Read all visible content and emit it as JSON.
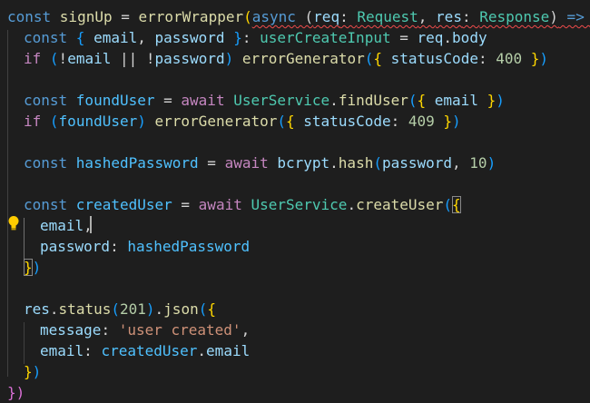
{
  "editor": {
    "lines": [
      [
        [
          "const ",
          "kw"
        ],
        [
          "signUp",
          "fn"
        ],
        [
          " = ",
          "punc"
        ],
        [
          "errorWrapper",
          "fn"
        ],
        [
          "(",
          "brace1"
        ],
        [
          "async",
          "kw sq"
        ],
        [
          " (",
          "punc sq"
        ],
        [
          "req",
          "var sq"
        ],
        [
          ": ",
          "punc sq"
        ],
        [
          "Request",
          "type sq"
        ],
        [
          ", ",
          "punc sq"
        ],
        [
          "res",
          "var sq"
        ],
        [
          ": ",
          "punc sq"
        ],
        [
          "Response",
          "type sq"
        ],
        [
          ")",
          "punc sq"
        ],
        [
          " => ",
          "kw sq"
        ],
        [
          "{",
          "brace2 sq"
        ]
      ],
      [
        [
          "const ",
          "kw"
        ],
        [
          "{ ",
          "brace3"
        ],
        [
          "email",
          "var"
        ],
        [
          ", ",
          "punc"
        ],
        [
          "password",
          "var"
        ],
        [
          " }",
          "brace3"
        ],
        [
          ": ",
          "punc"
        ],
        [
          "userCreateInput",
          "type"
        ],
        [
          " = ",
          "punc"
        ],
        [
          "req",
          "var"
        ],
        [
          ".",
          "punc"
        ],
        [
          "body",
          "var"
        ]
      ],
      [
        [
          "if ",
          "ctrl"
        ],
        [
          "(",
          "brace3"
        ],
        [
          "!",
          "punc"
        ],
        [
          "email",
          "var"
        ],
        [
          " || ",
          "punc"
        ],
        [
          "!",
          "punc"
        ],
        [
          "password",
          "var"
        ],
        [
          ") ",
          "brace3"
        ],
        [
          "errorGenerator",
          "fn"
        ],
        [
          "(",
          "brace3"
        ],
        [
          "{ ",
          "brace1"
        ],
        [
          "statusCode",
          "var"
        ],
        [
          ": ",
          "punc"
        ],
        [
          "400",
          "num"
        ],
        [
          " }",
          "brace1"
        ],
        [
          ")",
          "brace3"
        ]
      ],
      [],
      [
        [
          "const ",
          "kw"
        ],
        [
          "foundUser",
          "const"
        ],
        [
          " = ",
          "punc"
        ],
        [
          "await ",
          "ctrl"
        ],
        [
          "UserService",
          "type"
        ],
        [
          ".",
          "punc"
        ],
        [
          "findUser",
          "fn"
        ],
        [
          "(",
          "brace3"
        ],
        [
          "{ ",
          "brace1"
        ],
        [
          "email",
          "var"
        ],
        [
          " }",
          "brace1"
        ],
        [
          ")",
          "brace3"
        ]
      ],
      [
        [
          "if ",
          "ctrl"
        ],
        [
          "(",
          "brace3"
        ],
        [
          "foundUser",
          "const"
        ],
        [
          ") ",
          "brace3"
        ],
        [
          "errorGenerator",
          "fn"
        ],
        [
          "(",
          "brace3"
        ],
        [
          "{ ",
          "brace1"
        ],
        [
          "statusCode",
          "var"
        ],
        [
          ": ",
          "punc"
        ],
        [
          "409",
          "num"
        ],
        [
          " }",
          "brace1"
        ],
        [
          ")",
          "brace3"
        ]
      ],
      [],
      [
        [
          "const ",
          "kw"
        ],
        [
          "hashedPassword",
          "const"
        ],
        [
          " = ",
          "punc"
        ],
        [
          "await ",
          "ctrl"
        ],
        [
          "bcrypt",
          "var"
        ],
        [
          ".",
          "punc"
        ],
        [
          "hash",
          "fn"
        ],
        [
          "(",
          "brace3"
        ],
        [
          "password",
          "var"
        ],
        [
          ", ",
          "punc"
        ],
        [
          "10",
          "num"
        ],
        [
          ")",
          "brace3"
        ]
      ],
      [],
      [
        [
          "const ",
          "kw"
        ],
        [
          "createdUser",
          "const"
        ],
        [
          " = ",
          "punc"
        ],
        [
          "await ",
          "ctrl"
        ],
        [
          "UserService",
          "type"
        ],
        [
          ".",
          "punc"
        ],
        [
          "createUser",
          "fn"
        ],
        [
          "(",
          "brace3"
        ],
        [
          "{",
          "brace1 match"
        ]
      ],
      [
        [
          "email",
          "var"
        ],
        [
          ",",
          "punc"
        ]
      ],
      [
        [
          "password",
          "var"
        ],
        [
          ": ",
          "punc"
        ],
        [
          "hashedPassword",
          "const"
        ]
      ],
      [
        [
          "}",
          "brace1 match"
        ],
        [
          ")",
          "brace3"
        ]
      ],
      [],
      [
        [
          "res",
          "var"
        ],
        [
          ".",
          "punc"
        ],
        [
          "status",
          "fn"
        ],
        [
          "(",
          "brace3"
        ],
        [
          "201",
          "num"
        ],
        [
          ")",
          "brace3"
        ],
        [
          ".",
          "punc"
        ],
        [
          "json",
          "fn"
        ],
        [
          "(",
          "brace3"
        ],
        [
          "{",
          "brace1"
        ]
      ],
      [
        [
          "message",
          "var"
        ],
        [
          ": ",
          "punc"
        ],
        [
          "'user created'",
          "str"
        ],
        [
          ",",
          "punc"
        ]
      ],
      [
        [
          "email",
          "var"
        ],
        [
          ": ",
          "punc"
        ],
        [
          "createdUser",
          "const"
        ],
        [
          ".",
          "punc"
        ],
        [
          "email",
          "var"
        ]
      ],
      [
        [
          "}",
          "brace1"
        ],
        [
          ")",
          "brace3"
        ]
      ],
      [
        [
          "})",
          "brace2"
        ]
      ]
    ]
  },
  "icons": {
    "lightbulb": "lightbulb-icon",
    "cursor": "text-cursor"
  },
  "colors": {
    "background": "#1e1e1e",
    "keyword": "#569cd6",
    "control": "#c586c0",
    "function": "#dcdcaa",
    "variable": "#9cdcfe",
    "constant": "#4fc1ff",
    "type": "#4ec9b0",
    "number": "#b5cea8",
    "string": "#ce9178",
    "error_squiggle": "#f14c4c"
  }
}
